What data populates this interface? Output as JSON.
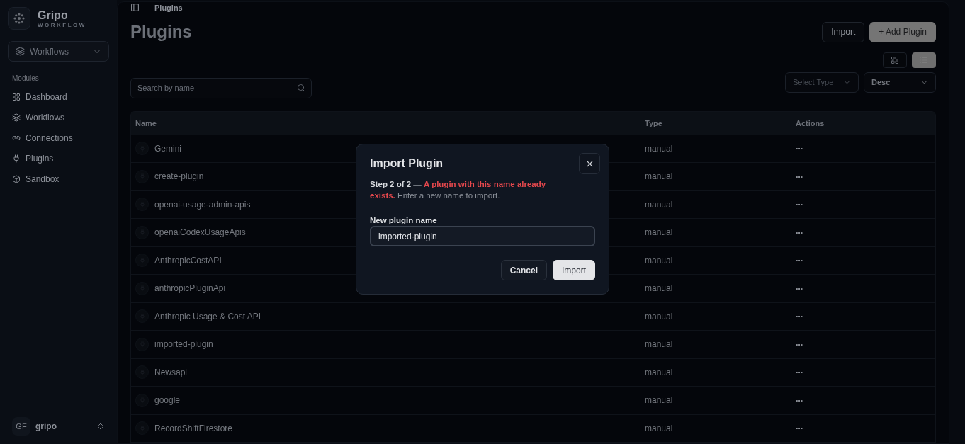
{
  "sidebar": {
    "brand": {
      "name": "Gripo",
      "tagline": "WORKFLOW"
    },
    "switcher": {
      "label": "Workflows"
    },
    "section_title": "Modules",
    "items": [
      {
        "kind": "dashboard",
        "label": "Dashboard",
        "selected": false
      },
      {
        "kind": "workflows",
        "label": "Workflows",
        "selected": false
      },
      {
        "kind": "connections",
        "label": "Connections",
        "selected": false
      },
      {
        "kind": "plugins",
        "label": "Plugins",
        "selected": false
      },
      {
        "kind": "sandbox",
        "label": "Sandbox",
        "selected": false
      }
    ],
    "user": {
      "initials": "GF",
      "name": "gripo"
    }
  },
  "breadcrumb": "Plugins",
  "page_title": "Plugins",
  "header_buttons": [
    {
      "kind": "secondary",
      "label": "Import"
    },
    {
      "kind": "primary",
      "label": "+ Add Plugin"
    }
  ],
  "view_toggle": [
    {
      "kind": "grid",
      "selected": false
    },
    {
      "kind": "list",
      "selected": true
    }
  ],
  "search": {
    "placeholder": "Search by name"
  },
  "filters": [
    {
      "placeholder": "Select Type"
    },
    {
      "value": "Desc"
    }
  ],
  "table": {
    "columns": [
      "Name",
      "Type",
      "Actions"
    ],
    "rows": [
      {
        "name": "Gemini",
        "type": "manual",
        "actions": "···"
      },
      {
        "name": "create-plugin",
        "type": "manual",
        "actions": "···"
      },
      {
        "name": "openai-usage-admin-apis",
        "type": "manual",
        "actions": "···"
      },
      {
        "name": "openaiCodexUsageApis",
        "type": "manual",
        "actions": "···"
      },
      {
        "name": "AnthropicCostAPI",
        "type": "manual",
        "actions": "···"
      },
      {
        "name": "anthropicPluginApi",
        "type": "manual",
        "actions": "···"
      },
      {
        "name": "Anthropic Usage & Cost API",
        "type": "manual",
        "actions": "···"
      },
      {
        "name": "imported-plugin",
        "type": "manual",
        "actions": "···"
      },
      {
        "name": "Newsapi",
        "type": "manual",
        "actions": "···"
      },
      {
        "name": "google",
        "type": "manual",
        "actions": "···"
      },
      {
        "name": "RecordShiftFirestore",
        "type": "manual",
        "actions": "···"
      }
    ]
  },
  "modal": {
    "title": "Import Plugin",
    "step": "Step 2 of 2",
    "separator": "—",
    "error": "A plugin with this name already exists.",
    "hint": "Enter a new name to import.",
    "field_label": "New plugin name",
    "field_value": "imported-plugin",
    "buttons": [
      {
        "kind": "secondary",
        "label": "Cancel"
      },
      {
        "kind": "primary",
        "label": "Import"
      }
    ]
  }
}
